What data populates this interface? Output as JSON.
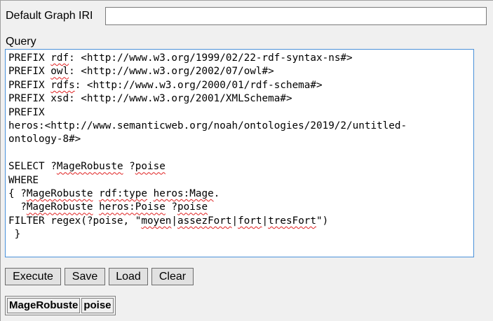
{
  "form": {
    "graph_iri_label": "Default Graph IRI",
    "graph_iri_value": "",
    "query_label": "Query"
  },
  "query": {
    "lines": [
      [
        {
          "t": "PREFIX "
        },
        {
          "t": "rdf",
          "s": true
        },
        {
          "t": ": <http://www.w3.org/1999/02/22-rdf-syntax-ns#>"
        }
      ],
      [
        {
          "t": "PREFIX "
        },
        {
          "t": "owl",
          "s": true
        },
        {
          "t": ": <http://www.w3.org/2002/07/owl#>"
        }
      ],
      [
        {
          "t": "PREFIX "
        },
        {
          "t": "rdfs",
          "s": true
        },
        {
          "t": ": <http://www.w3.org/2000/01/rdf-schema#>"
        }
      ],
      [
        {
          "t": "PREFIX xsd: <http://www.w3.org/2001/XMLSchema#>"
        }
      ],
      [
        {
          "t": "PREFIX"
        }
      ],
      [
        {
          "t": "heros:<http://www.semanticweb.org/noah/ontologies/2019/2/untitled-"
        }
      ],
      [
        {
          "t": "ontology-8#>"
        }
      ],
      [
        {
          "t": ""
        }
      ],
      [
        {
          "t": "SELECT ?"
        },
        {
          "t": "MageRobuste",
          "s": true
        },
        {
          "t": " ?"
        },
        {
          "t": "poise",
          "s": true
        }
      ],
      [
        {
          "t": "WHERE"
        }
      ],
      [
        {
          "t": "{ ?"
        },
        {
          "t": "MageRobuste",
          "s": true
        },
        {
          "t": " "
        },
        {
          "t": "rdf:type",
          "s": true
        },
        {
          "t": " "
        },
        {
          "t": "heros:Mage",
          "s": true
        },
        {
          "t": "."
        }
      ],
      [
        {
          "t": "  ?"
        },
        {
          "t": "MageRobuste",
          "s": true
        },
        {
          "t": " "
        },
        {
          "t": "heros:Poise",
          "s": true
        },
        {
          "t": " ?"
        },
        {
          "t": "poise",
          "s": true
        }
      ],
      [
        {
          "t": "FILTER regex(?poise, \""
        },
        {
          "t": "moyen",
          "s": true
        },
        {
          "t": "|"
        },
        {
          "t": "assezFort",
          "s": true
        },
        {
          "t": "|"
        },
        {
          "t": "fort",
          "s": true
        },
        {
          "t": "|"
        },
        {
          "t": "tresFort",
          "s": true
        },
        {
          "t": "\")"
        }
      ],
      [
        {
          "t": " }"
        }
      ]
    ]
  },
  "buttons": {
    "execute": "Execute",
    "save": "Save",
    "load": "Load",
    "clear": "Clear"
  },
  "results": {
    "columns": [
      "MageRobuste",
      "poise"
    ]
  }
}
